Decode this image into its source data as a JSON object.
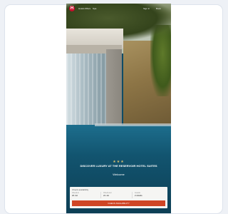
{
  "brand": {
    "logo_letter": "H"
  },
  "nav": {
    "items": [
      "Hotels",
      "Offers",
      "Spa"
    ],
    "right_items": [
      "Sign in",
      "Book"
    ]
  },
  "hero": {
    "stars": "★★★",
    "headline": "DISCOVER LUXURY AT THE RESERVOIR HOTEL SUITES",
    "subheadline": "Welcome"
  },
  "booking": {
    "title": "Check availability",
    "fields": [
      {
        "label": "Check-in",
        "value": "20 Jul"
      },
      {
        "label": "Check-out",
        "value": "21 Jul"
      },
      {
        "label": "Guests",
        "value": "2 Adults"
      }
    ],
    "cta_label": "CHECK AVAILABILITY"
  },
  "footer": {
    "text": ""
  },
  "colors": {
    "cta": "#cf4525",
    "logo": "#c8102e",
    "pool": "#12546f"
  }
}
